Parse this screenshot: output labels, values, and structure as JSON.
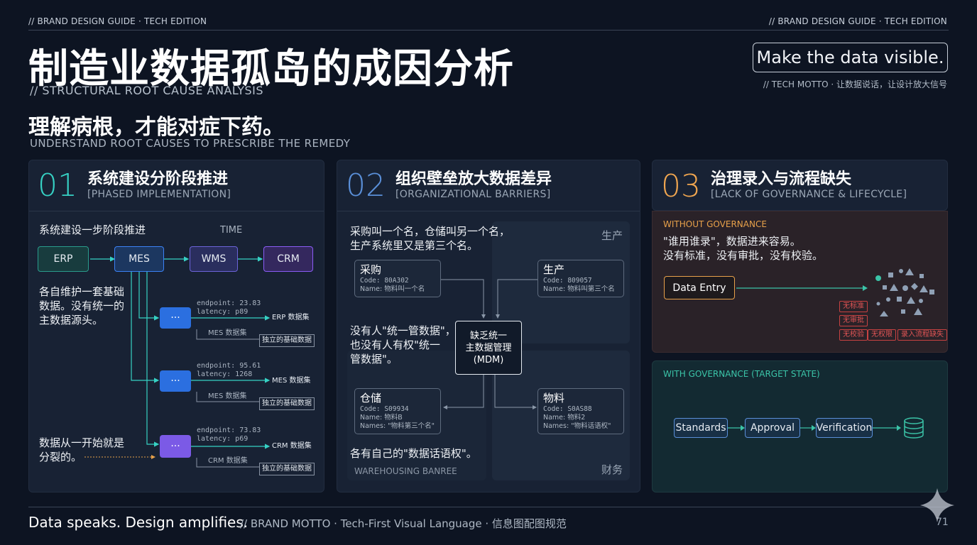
{
  "header": {
    "label_left": "// BRAND DESIGN GUIDE · TECH EDITION",
    "label_right": "// BRAND DESIGN GUIDE · TECH EDITION"
  },
  "title": "制造业数据孤岛的成因分析",
  "subtitle": "// STRUCTURAL ROOT CAUSE ANALYSIS",
  "lead": "理解病根，才能对症下药。",
  "lead_en": "UNDERSTAND ROOT CAUSES TO PRESCRIBE THE REMEDY",
  "motto": {
    "text": "Make the data visible.",
    "sub": "// TECH MOTTO · 让数据说话，让设计放大信号"
  },
  "panel1": {
    "num": "01",
    "title": "系统建设分阶段推进",
    "sub": "[PHASED IMPLEMENTATION]",
    "caption": "系统建设一步阶段推进",
    "time": "TIME",
    "systems": [
      "ERP",
      "MES",
      "WMS",
      "CRM"
    ],
    "text1": [
      "各自维护一套基础",
      "数据。没有统一的",
      "主数据源头。"
    ],
    "text2": [
      "数据从一开始就是",
      "分裂的。"
    ],
    "nodes": [
      {
        "label": "···",
        "endpoint": "endpoint: 23.83",
        "latency": "latency: p89",
        "target": "ERP 数据集",
        "source": "MES 数据集",
        "box": "独立的基础数据"
      },
      {
        "label": "···",
        "endpoint": "endpoint: 95.61",
        "latency": "latency: 1268",
        "target": "MES 数据集",
        "source": "MES 数据集",
        "box": "独立的基础数据"
      },
      {
        "label": "···",
        "endpoint": "endpoint: 73.83",
        "latency": "latency: p69",
        "target": "CRM 数据集",
        "source": "CRM 数据集",
        "box": "独立的基础数据"
      }
    ],
    "colors": {
      "accent": "#36d1c4",
      "erp": "#2a9c8c",
      "mes": "#3b82f6",
      "wms": "#6c63d9",
      "crm": "#8b5cf6"
    }
  },
  "panel2": {
    "num": "02",
    "title": "组织壁垒放大数据差异",
    "sub": "[ORGANIZATIONAL BARRIERS]",
    "intro": [
      "采购叫一个名，仓储叫另一个名，",
      "生产系统里又是第三个名。"
    ],
    "zone_production": "生产",
    "zone_finance": "财务",
    "center": [
      "缺乏统一",
      "主数据管理",
      "(MDM)"
    ],
    "mid_text": [
      "没有人\"统一管数据\"，",
      "也没有人有权\"统一",
      "管数据\"。"
    ],
    "bottom_text": "各有自己的\"数据话语权\"。",
    "bottom_label": "WAREHOUSING BANREE",
    "cards": {
      "purchase": {
        "title": "采购",
        "code": "Code: 80A302",
        "name": "Name: 物料叫一个名"
      },
      "production": {
        "title": "生产",
        "code": "Code: 809057",
        "name": "Name: 物料叫第三个名"
      },
      "warehouse": {
        "title": "仓储",
        "code": "Code: S09934",
        "name": "Name: 物料B",
        "names": "Names: \"物料第三个名\""
      },
      "material": {
        "title": "物料",
        "code": "Code: S0AS88",
        "name": "Name: 物料2",
        "names": "Names: \"物料话语权\""
      }
    },
    "colors": {
      "accent": "#5a8fd8"
    }
  },
  "panel3": {
    "num": "03",
    "title": "治理录入与流程缺失",
    "sub": "[LACK OF GOVERNANCE & LIFECYCLE]",
    "without_label": "WITHOUT GOVERNANCE",
    "without_text": [
      "\"谁用谁录\"，数据进来容易。",
      "没有标准，没有审批，没有校验。"
    ],
    "data_entry": "Data Entry",
    "error_tags": [
      "无标准",
      "无审批",
      "无校验",
      "无权限",
      "录入流程缺失"
    ],
    "with_label": "WITH GOVERNANCE (TARGET STATE)",
    "steps": [
      "Standards",
      "Approval",
      "Verification"
    ],
    "db_icon": "database-icon",
    "colors": {
      "accent": "#f0a650",
      "without": "#e8a14a",
      "with": "#3bc4a8",
      "error": "#e25555"
    }
  },
  "footer": {
    "main": "Data speaks. Design amplifies.",
    "sub": "// BRAND MOTTO · Tech-First Visual Language · 信息图配图规范",
    "page": "71"
  }
}
